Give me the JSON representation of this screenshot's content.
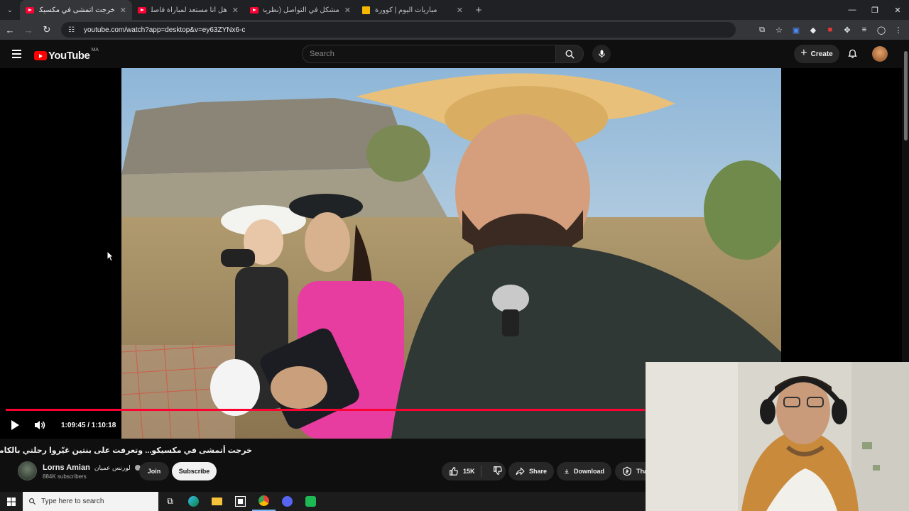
{
  "browser": {
    "tabs": [
      {
        "title": "خرجت أتمشى في مكسيكو... وتعرفت على بنتين غيّروا رحلتي بالكامل",
        "favicon": "youtube-icon",
        "active": true
      },
      {
        "title": "هل أنا مستعد لمباراة فاصلة؟ اتش التأهل للدور الثاني؟ التشكيلة",
        "favicon": "youtube-icon",
        "active": false
      },
      {
        "title": "مشكل في التواصل (نظرية البراغي)",
        "favicon": "youtube-icon",
        "active": false
      },
      {
        "title": "مباريات اليوم | كوورة",
        "favicon": "kooora-icon",
        "active": false
      }
    ],
    "url": "youtube.com/watch?app=desktop&v=ey63ZYNx6-c"
  },
  "youtube": {
    "logo_text": "YouTube",
    "country_code": "MA",
    "search_placeholder": "Search",
    "create_label": "Create"
  },
  "player": {
    "time_current": "1:09:45",
    "time_total": "1:10:18",
    "time_display": "1:09:45 / 1:10:18",
    "progress": 0.992
  },
  "video": {
    "title": "خرجت أتمشى في مكسيكو... وتعرفت على بنتين غيّروا رحلتي بالكامل MX",
    "channel_name": "Lorns Amian",
    "channel_name_ar": "لورنس عميان",
    "subscribers": "884K subscribers",
    "join_label": "Join",
    "subscribe_label": "Subscribe",
    "like_count": "15K",
    "share_label": "Share",
    "download_label": "Download",
    "thanks_label": "Tha"
  },
  "taskbar": {
    "search_placeholder": "Type here to search"
  }
}
